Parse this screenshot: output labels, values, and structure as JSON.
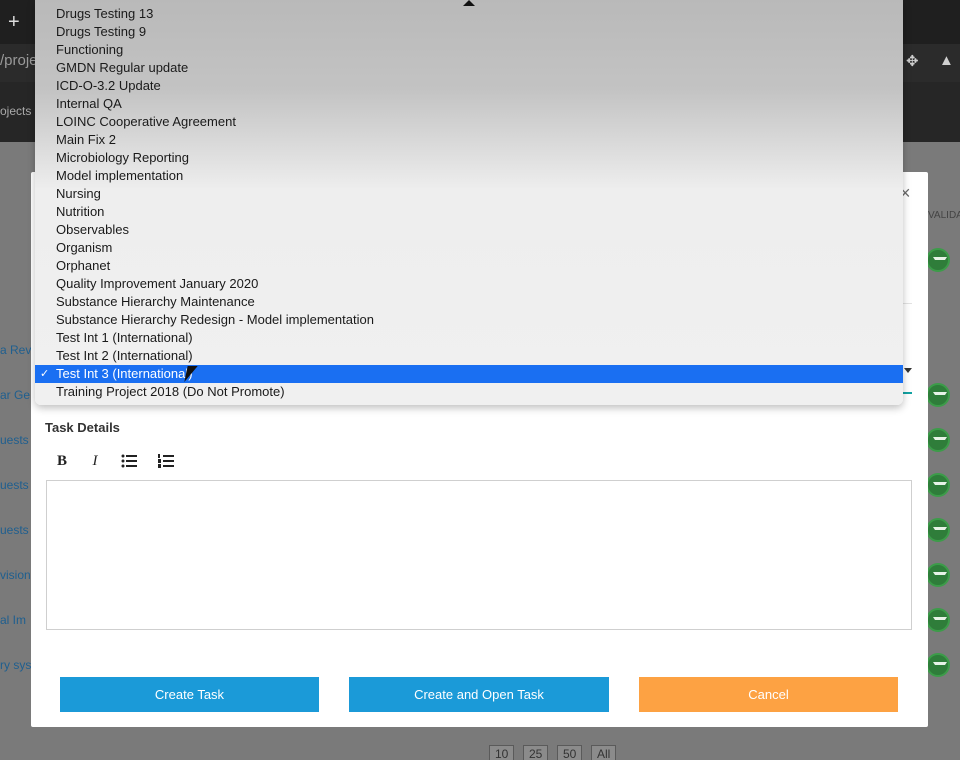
{
  "browser": {
    "new_tab_label": "+",
    "url_fragment": "/proje",
    "nav_fragment": "ojects"
  },
  "background": {
    "column_header": "VALIDA",
    "row_links": [
      "a Revi",
      "ar Ge",
      "uests",
      "uests",
      "uests",
      "vision",
      "al Im",
      "ry sys"
    ],
    "pagination": [
      "10",
      "25",
      "50",
      "All"
    ]
  },
  "dropdown": {
    "options": [
      "Drugs Testing 13",
      "Drugs Testing 9",
      "Functioning",
      "GMDN Regular update",
      "ICD-O-3.2 Update",
      "Internal QA",
      "LOINC Cooperative Agreement",
      "Main Fix 2",
      "Microbiology Reporting",
      "Model implementation",
      "Nursing",
      "Nutrition",
      "Observables",
      "Organism",
      "Orphanet",
      "Quality Improvement January 2020",
      "Substance Hierarchy Maintenance",
      "Substance Hierarchy Redesign - Model implementation",
      "Test Int 1 (International)",
      "Test Int 2 (International)",
      "Test Int 3 (International)",
      "Training Project 2018 (Do Not Promote)"
    ],
    "selected_index": 20,
    "check_glyph": "✓"
  },
  "modal": {
    "close_glyph": "×",
    "task_details_label": "Task Details",
    "toolbar": {
      "bold": "B",
      "italic": "I"
    },
    "buttons": {
      "create": "Create Task",
      "create_open": "Create and Open Task",
      "cancel": "Cancel"
    }
  },
  "colors": {
    "primary": "#1b9ad8",
    "cancel": "#fda243",
    "selection": "#1a6ff2",
    "focus_line": "#12a3a3"
  }
}
